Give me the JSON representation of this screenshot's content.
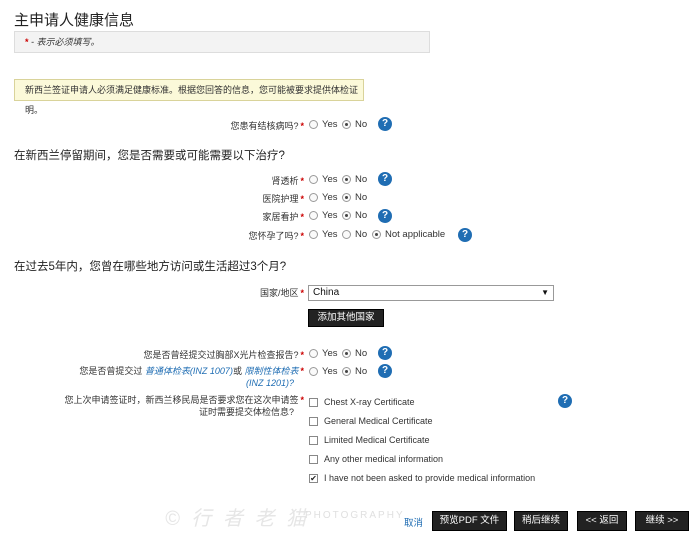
{
  "title": "主申请人健康信息",
  "required_note": {
    "star": "*",
    "text": "- 表示必须填写。"
  },
  "notice": "新西兰签证申请人必须满足健康标准。根据您回答的信息，您可能被要求提供体检证明。",
  "tb_question": {
    "label": "您患有结核病吗?",
    "req": "*",
    "yes": "Yes",
    "no": "No",
    "help": "?"
  },
  "treatment_heading": "在新西兰停留期间，您是否需要或可能需要以下治疗?",
  "treatments": [
    {
      "label": "肾透析",
      "req": "*",
      "yes": "Yes",
      "no": "No",
      "help": "?"
    },
    {
      "label": "医院护理",
      "req": "*",
      "yes": "Yes",
      "no": "No"
    },
    {
      "label": "家居看护",
      "req": "*",
      "yes": "Yes",
      "no": "No",
      "help": "?"
    },
    {
      "label": "您怀孕了吗?",
      "req": "*",
      "yes": "Yes",
      "no": "No",
      "na": "Not applicable",
      "help": "?"
    }
  ],
  "countries_heading": "在过去5年内，您曾在哪些地方访问或生活超过3个月?",
  "country": {
    "label": "国家/地区",
    "req": "*",
    "value": "China",
    "arrow": "▼",
    "add_button": "添加其他国家"
  },
  "xray_question": {
    "label": "您是否曾经提交过胸部X光片检查报告?",
    "req": "*",
    "yes": "Yes",
    "no": "No",
    "help": "?"
  },
  "medical_question": {
    "prefix": "您是否曾提交过",
    "link1": "普通体检表(INZ 1007)",
    "middle": "或",
    "link2": "限制性体检表",
    "link2b": "(INZ 1201)?",
    "req": "*",
    "yes": "Yes",
    "no": "No",
    "help": "?"
  },
  "last_application": {
    "line1": "您上次申请签证时，新西兰移民局是否要求您在这次申请签",
    "line2": "证时需要提交体检信息?",
    "req": "*",
    "help": "?",
    "options": [
      {
        "label": "Chest X-ray Certificate",
        "checked": false
      },
      {
        "label": "General Medical Certificate",
        "checked": false
      },
      {
        "label": "Limited Medical Certificate",
        "checked": false
      },
      {
        "label": "Any other medical information",
        "checked": false
      },
      {
        "label": "I have not been asked to provide medical information",
        "checked": true
      }
    ],
    "check_mark": "✔"
  },
  "footer": {
    "cancel": "取消",
    "preview_pdf": "预览PDF 文件",
    "save_later": "稍后继续",
    "back": "<< 返回",
    "continue": "继续 >>"
  },
  "watermark": {
    "text": "© 行 者 老 猫",
    "sub": "PHOTOGRAPHY"
  }
}
